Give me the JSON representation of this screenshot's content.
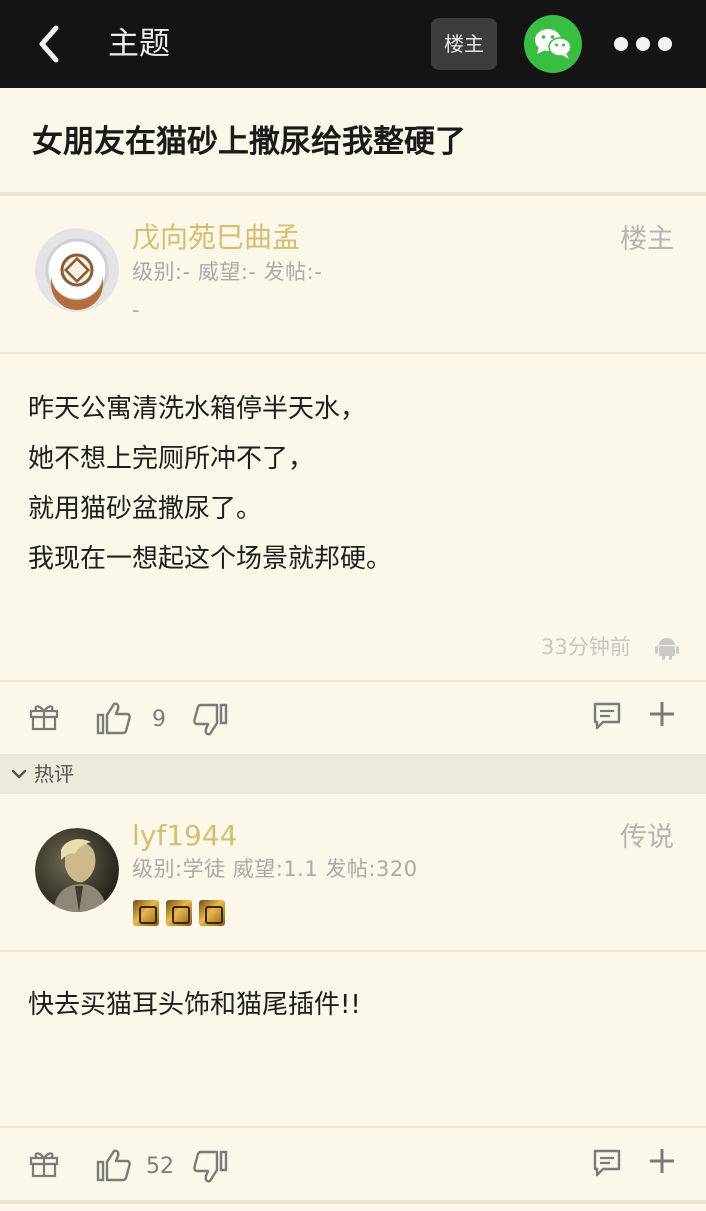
{
  "header": {
    "title": "主题",
    "op_button": "楼主"
  },
  "thread": {
    "title": "女朋友在猫砂上撒尿给我整硬了"
  },
  "original_post": {
    "username": "戊向苑巳曲孟",
    "meta": "级别:- 威望:- 发帖:-",
    "meta_extra": "-",
    "role": "楼主",
    "body": [
      "昨天公寓清洗水箱停半天水，",
      "她不想上完厕所冲不了，",
      "就用猫砂盆撒尿了。",
      "我现在一想起这个场景就邦硬。"
    ],
    "time": "33分钟前",
    "device_icon": "android-icon",
    "likes": "9"
  },
  "hot_section": {
    "label": "热评"
  },
  "hot_comment": {
    "username": "lyf1944",
    "meta": "级别:学徒 威望:1.1 发帖:320",
    "role": "传说",
    "body": "快去买猫耳头饰和猫尾插件!!",
    "likes": "52"
  },
  "colors": {
    "topbar": "#141414",
    "page_bg": "#fbf8e9",
    "username": "#d6bd72",
    "wechat": "#39bd42"
  }
}
